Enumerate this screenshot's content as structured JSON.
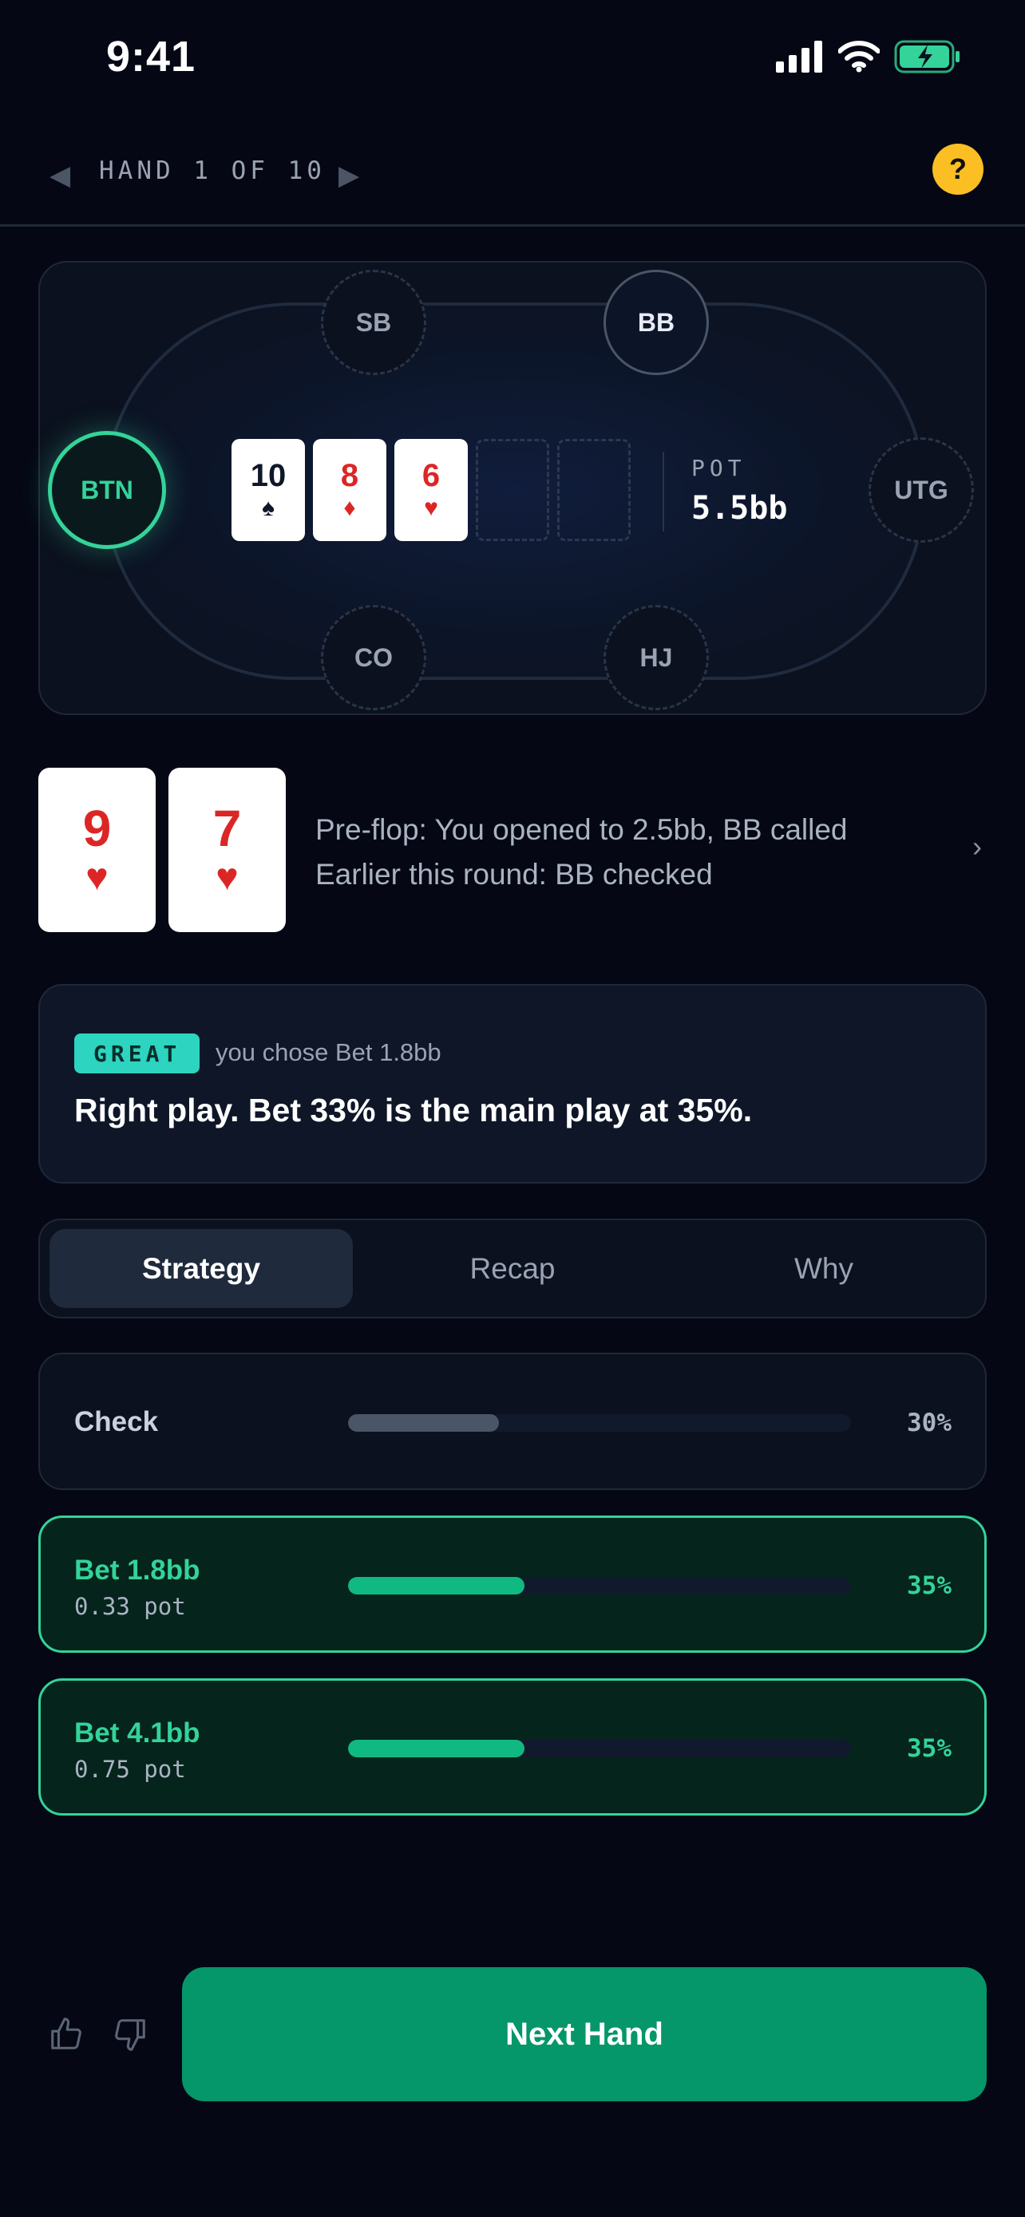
{
  "status_bar": {
    "time": "9:41"
  },
  "header": {
    "hand_label": "HAND 1 OF 10",
    "help_label": "?"
  },
  "table": {
    "seats": {
      "sb": "SB",
      "bb": "BB",
      "btn": "BTN",
      "utg": "UTG",
      "co": "CO",
      "hj": "HJ"
    },
    "board": [
      {
        "rank": "10",
        "suit": "♠",
        "color": "#0f172a"
      },
      {
        "rank": "8",
        "suit": "♦",
        "color": "#dc2626"
      },
      {
        "rank": "6",
        "suit": "♥",
        "color": "#dc2626"
      }
    ],
    "pot_label": "POT",
    "pot_value": "5.5bb"
  },
  "hero": {
    "cards": [
      {
        "rank": "9",
        "suit": "♥"
      },
      {
        "rank": "7",
        "suit": "♥"
      }
    ],
    "history": [
      "Pre-flop: You opened to 2.5bb, BB called",
      "Earlier this round: BB checked"
    ],
    "chevron": "›"
  },
  "verdict": {
    "badge": "GREAT",
    "chose": "you chose Bet 1.8bb",
    "message": "Right play. Bet 33% is the main play at 35%."
  },
  "tabs": [
    "Strategy",
    "Recap",
    "Why"
  ],
  "actions": [
    {
      "name": "Check",
      "sub": "",
      "pct_label": "30%",
      "frequency": 0.3,
      "highlight": false
    },
    {
      "name": "Bet 1.8bb",
      "sub": "0.33 pot",
      "pct_label": "35%",
      "frequency": 0.35,
      "highlight": true
    },
    {
      "name": "Bet 4.1bb",
      "sub": "0.75 pot",
      "pct_label": "35%",
      "frequency": 0.35,
      "highlight": true
    }
  ],
  "footer": {
    "next_label": "Next Hand"
  },
  "colors": {
    "accent": "#34d399",
    "primary_button": "#059669",
    "badge": "#2dd4bf",
    "help": "#fbbf24",
    "neutral_bar": "#4a5568"
  }
}
